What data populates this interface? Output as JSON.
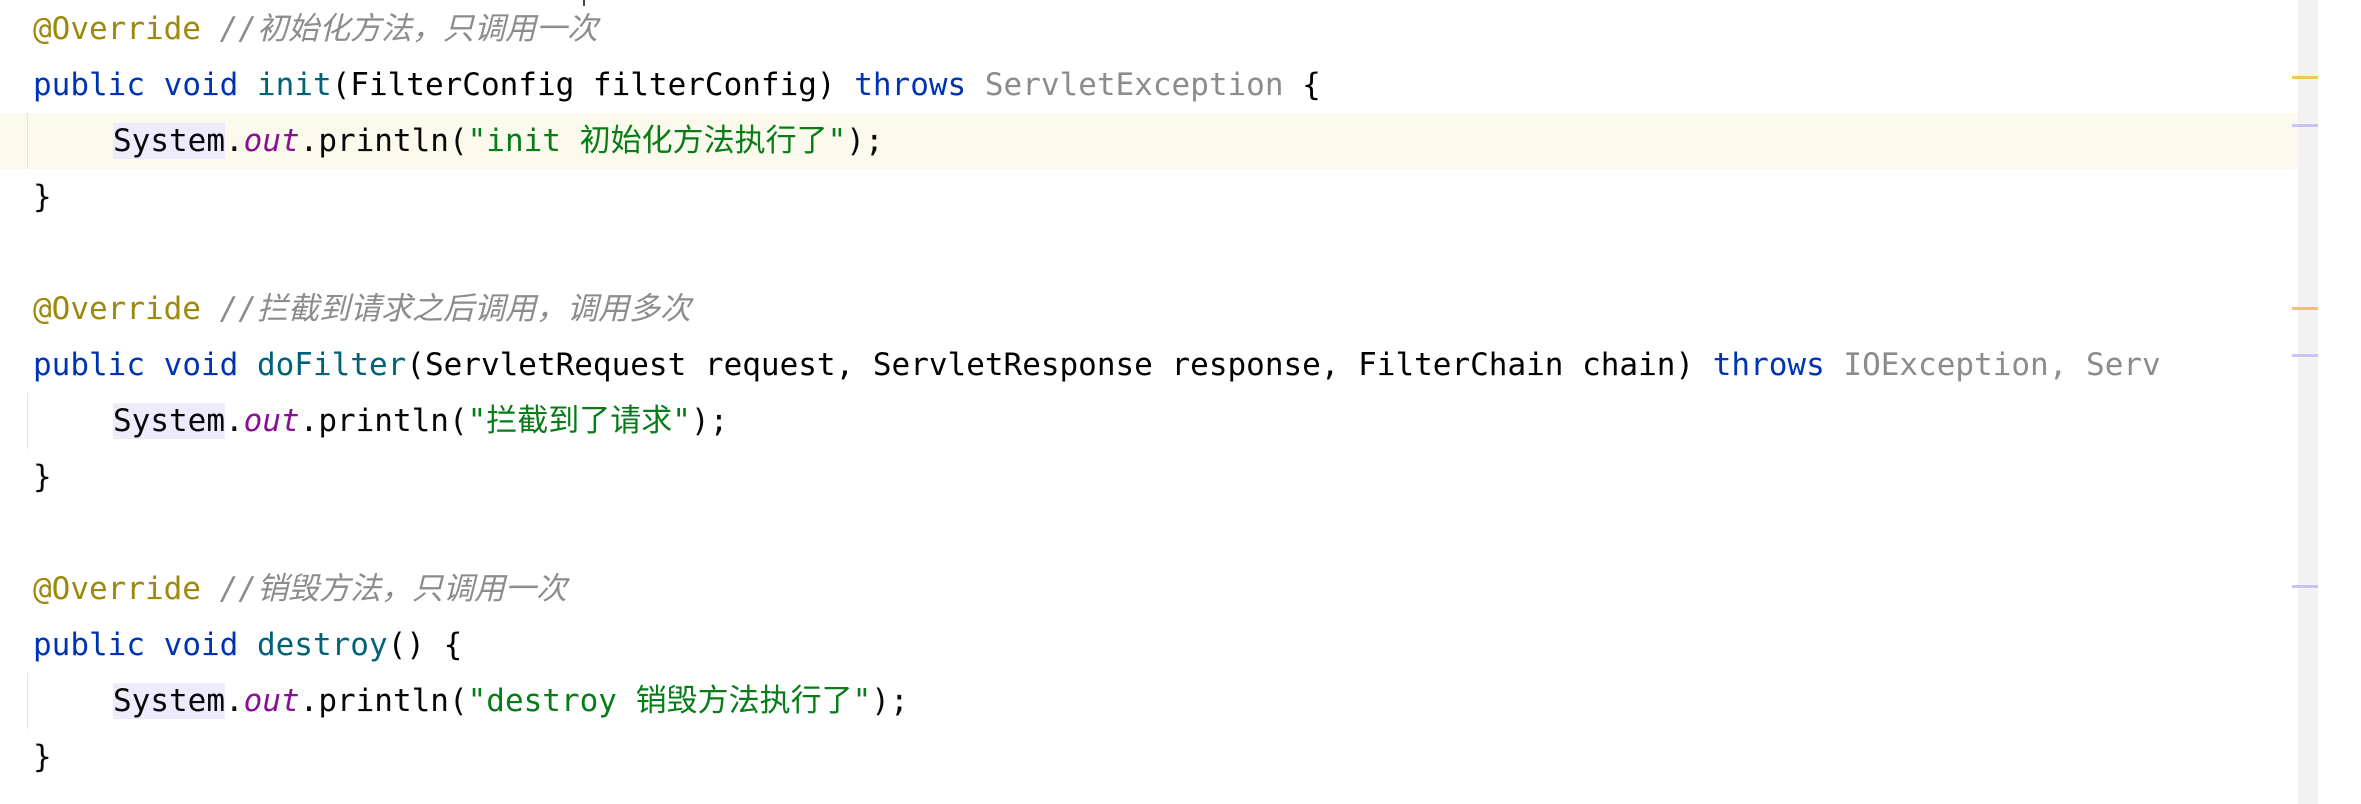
{
  "editor": {
    "lines": [
      {
        "annotation": "@Override",
        "comment": " //初始化方法，只调用一次"
      },
      {
        "kw_public": "public",
        "kw_void": "void",
        "method": "init",
        "params": "(FilterConfig filterConfig) ",
        "kw_throws": "throws",
        "exception": "ServletException",
        "tail": " {"
      },
      {
        "system": "System",
        "dot1": ".",
        "field": "out",
        "call": ".println(",
        "string": "\"init 初始化方法执行了\"",
        "end": ");"
      },
      {
        "text": "}"
      },
      {
        "text": ""
      },
      {
        "annotation": "@Override",
        "comment": " //拦截到请求之后调用，调用多次"
      },
      {
        "kw_public": "public",
        "kw_void": "void",
        "method": "doFilter",
        "params": "(ServletRequest request, ServletResponse response, FilterChain chain) ",
        "kw_throws": "throws",
        "exception": "IOException, Serv"
      },
      {
        "system": "System",
        "dot1": ".",
        "field": "out",
        "call": ".println(",
        "string": "\"拦截到了请求\"",
        "end": ");"
      },
      {
        "text": "}"
      },
      {
        "text": ""
      },
      {
        "annotation": "@Override",
        "comment": " //销毁方法，只调用一次"
      },
      {
        "kw_public": "public",
        "kw_void": "void",
        "method": "destroy",
        "params": "() {"
      },
      {
        "system": "System",
        "dot1": ".",
        "field": "out",
        "call": ".println(",
        "string": "\"destroy 销毁方法执行了\"",
        "end": ");"
      },
      {
        "text": "}"
      }
    ]
  },
  "colors": {
    "annotation": "#9e880d",
    "comment": "#8c8c8c",
    "keyword": "#0033b3",
    "method": "#00627a",
    "string": "#067d17",
    "static_field": "#871094",
    "current_line": "#fcfaed"
  }
}
